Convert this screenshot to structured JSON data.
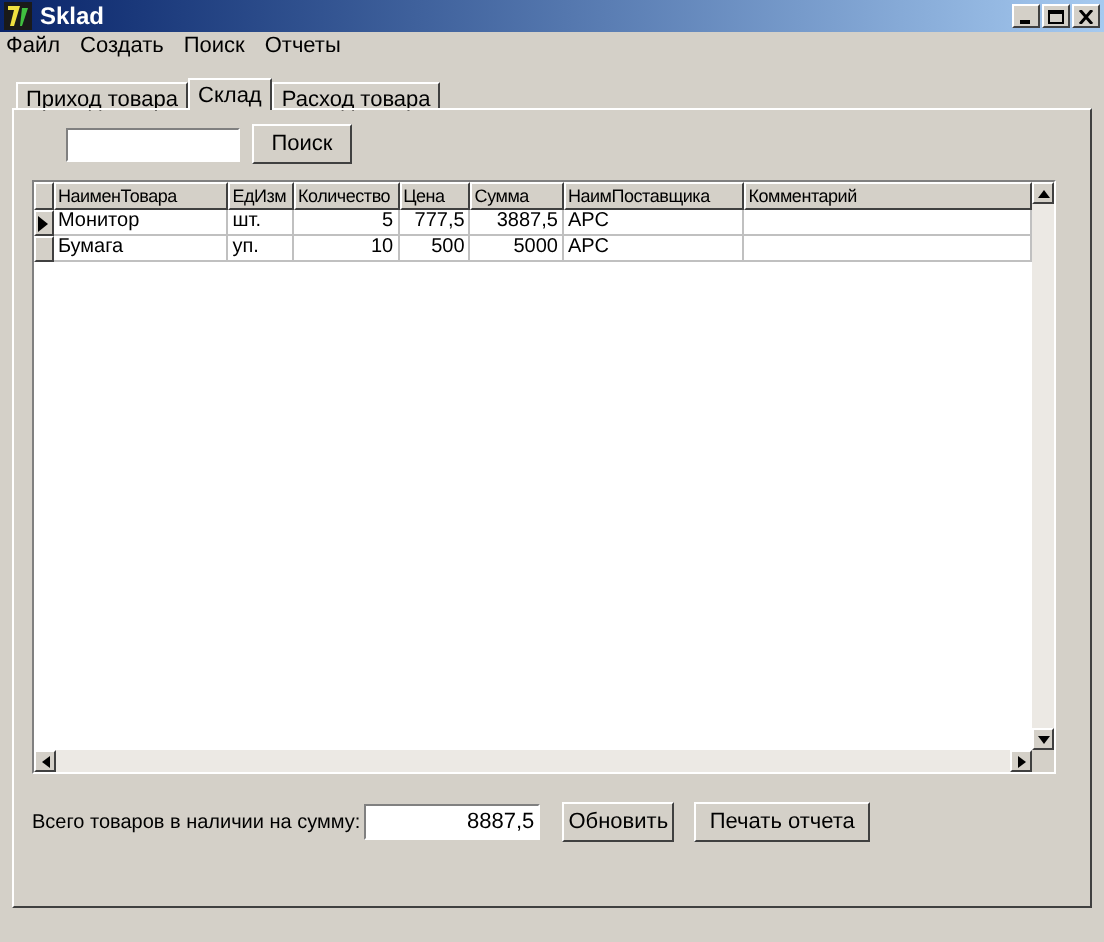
{
  "window": {
    "title": "Sklad"
  },
  "menu": [
    "Файл",
    "Создать",
    "Поиск",
    "Отчеты"
  ],
  "tabs": [
    {
      "label": "Приход товара",
      "selected": false
    },
    {
      "label": "Склад",
      "selected": true
    },
    {
      "label": "Расход товара",
      "selected": false
    }
  ],
  "search": {
    "button": "Поиск"
  },
  "table": {
    "columns": [
      "НаименТовара",
      "ЕдИзм",
      "Количество",
      "Цена",
      "Сумма",
      "НаимПоставщика",
      "Комментарий"
    ],
    "rows": [
      {
        "selected": true,
        "cells": [
          "Монитор",
          "шт.",
          "5",
          "777,5",
          "3887,5",
          "APC",
          ""
        ]
      },
      {
        "selected": false,
        "cells": [
          "Бумага",
          "уп.",
          "10",
          "500",
          "5000",
          "APC",
          ""
        ]
      }
    ]
  },
  "total": {
    "label": "Всего товаров в наличии на сумму:",
    "value": "8887,5"
  },
  "buttons": [
    "Обновить",
    "Печать отчета"
  ]
}
